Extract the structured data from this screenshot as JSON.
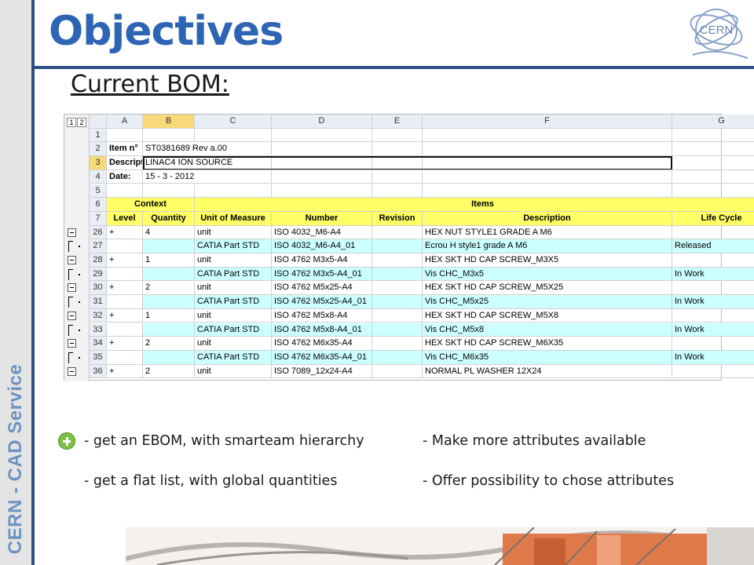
{
  "slide": {
    "title": "Objectives",
    "subtitle": "Current BOM:",
    "side_label": "CERN - CAD Service",
    "logo_text": "CERN"
  },
  "spreadsheet": {
    "outline_levels": [
      "1",
      "2"
    ],
    "columns": [
      "A",
      "B",
      "C",
      "D",
      "E",
      "F",
      "G"
    ],
    "rows": [
      {
        "n": "1",
        "cells": []
      },
      {
        "n": "2",
        "cells": [
          "Item n°",
          "ST0381689 Rev a.00"
        ]
      },
      {
        "n": "3",
        "cells": [
          "Descript",
          "LINAC4 ION SOURCE"
        ]
      },
      {
        "n": "4",
        "cells": [
          "Date:",
          "15 - 3 - 2012"
        ]
      },
      {
        "n": "5",
        "cells": []
      },
      {
        "n": "6",
        "context": "Context",
        "items": "Items"
      },
      {
        "n": "7",
        "headers": [
          "Level",
          "Quantity",
          "Unit of Measure",
          "Number",
          "Revision",
          "Description",
          "Life Cycle"
        ]
      }
    ],
    "data_rows": [
      {
        "n": "26",
        "level": "+",
        "qty": "4",
        "uom": "unit",
        "number": "ISO 4032_M6-A4",
        "rev": "",
        "desc": "HEX NUT STYLE1 GRADE A M6",
        "life": "",
        "cyan": false
      },
      {
        "n": "27",
        "level": "",
        "qty": "",
        "uom": "CATIA Part STD",
        "number": "ISO 4032_M6-A4_01",
        "rev": "",
        "desc": "Ecrou H style1 grade A M6",
        "life": "Released",
        "cyan": true
      },
      {
        "n": "28",
        "level": "+",
        "qty": "1",
        "uom": "unit",
        "number": "ISO 4762 M3x5-A4",
        "rev": "",
        "desc": "HEX SKT HD CAP SCREW_M3X5",
        "life": "",
        "cyan": false
      },
      {
        "n": "29",
        "level": "",
        "qty": "",
        "uom": "CATIA Part STD",
        "number": "ISO 4762 M3x5-A4_01",
        "rev": "",
        "desc": "Vis CHC_M3x5",
        "life": "In Work",
        "cyan": true
      },
      {
        "n": "30",
        "level": "+",
        "qty": "2",
        "uom": "unit",
        "number": "ISO 4762 M5x25-A4",
        "rev": "",
        "desc": "HEX SKT HD CAP SCREW_M5X25",
        "life": "",
        "cyan": false
      },
      {
        "n": "31",
        "level": "",
        "qty": "",
        "uom": "CATIA Part STD",
        "number": "ISO 4762 M5x25-A4_01",
        "rev": "",
        "desc": "Vis CHC_M5x25",
        "life": "In Work",
        "cyan": true
      },
      {
        "n": "32",
        "level": "+",
        "qty": "1",
        "uom": "unit",
        "number": "ISO 4762 M5x8-A4",
        "rev": "",
        "desc": "HEX SKT HD CAP SCREW_M5X8",
        "life": "",
        "cyan": false
      },
      {
        "n": "33",
        "level": "",
        "qty": "",
        "uom": "CATIA Part STD",
        "number": "ISO 4762 M5x8-A4_01",
        "rev": "",
        "desc": "Vis CHC_M5x8",
        "life": "In Work",
        "cyan": true
      },
      {
        "n": "34",
        "level": "+",
        "qty": "2",
        "uom": "unit",
        "number": "ISO 4762 M6x35-A4",
        "rev": "",
        "desc": "HEX SKT HD CAP SCREW_M6X35",
        "life": "",
        "cyan": false
      },
      {
        "n": "35",
        "level": "",
        "qty": "",
        "uom": "CATIA Part STD",
        "number": "ISO 4762 M6x35-A4_01",
        "rev": "",
        "desc": "Vis CHC_M6x35",
        "life": "In Work",
        "cyan": true
      },
      {
        "n": "36",
        "level": "+",
        "qty": "2",
        "uom": "unit",
        "number": "ISO 7089_12x24-A4",
        "rev": "",
        "desc": "NORMAL PL WASHER 12X24",
        "life": "",
        "cyan": false
      }
    ]
  },
  "objectives": {
    "left": [
      "- get an EBOM, with smarteam hierarchy",
      "- get a flat list, with global quantities"
    ],
    "right": [
      "- Make more attributes available",
      "- Offer possibility to chose attributes"
    ]
  },
  "colors": {
    "accent": "#2d65b4",
    "header_yellow": "#ffff66",
    "row_cyan": "#ccffff",
    "plus_green": "#7cc242"
  }
}
